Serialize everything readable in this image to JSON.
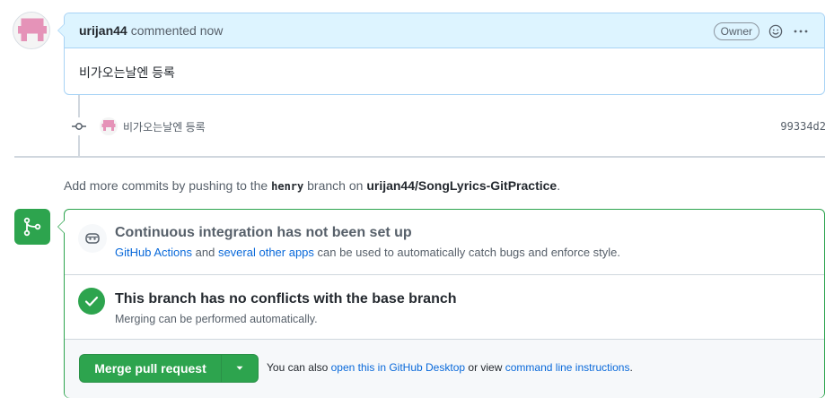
{
  "comment": {
    "author": "urijan44",
    "action_text": "commented now",
    "badge": "Owner",
    "body": "비가오는날엔 등록"
  },
  "commit": {
    "message": "비가오는날엔 등록",
    "sha": "99334d2"
  },
  "push_hint": {
    "prefix": "Add more commits by pushing to the",
    "branch": "henry",
    "middle": "branch on",
    "repo": "urijan44/SongLyrics-GitPractice",
    "suffix": "."
  },
  "ci": {
    "title": "Continuous integration has not been set up",
    "link1": "GitHub Actions",
    "text1": "and",
    "link2": "several other apps",
    "text2": "can be used to automatically catch bugs and enforce style."
  },
  "conflicts": {
    "title": "This branch has no conflicts with the base branch",
    "subtitle": "Merging can be performed automatically."
  },
  "actions": {
    "merge_label": "Merge pull request",
    "prefix": "You can also",
    "link_desktop": "open this in GitHub Desktop",
    "middle": "or view",
    "link_cli": "command line instructions",
    "suffix": "."
  },
  "colors": {
    "accent": "#0969da",
    "success": "#2da44e",
    "comment_header": "#ddf4ff"
  },
  "icons": [
    "identicon-avatar",
    "smiley-icon",
    "kebab-icon",
    "git-commit-icon",
    "git-branch-icon",
    "ci-robot-icon",
    "check-circle-icon",
    "triangle-down-icon"
  ]
}
